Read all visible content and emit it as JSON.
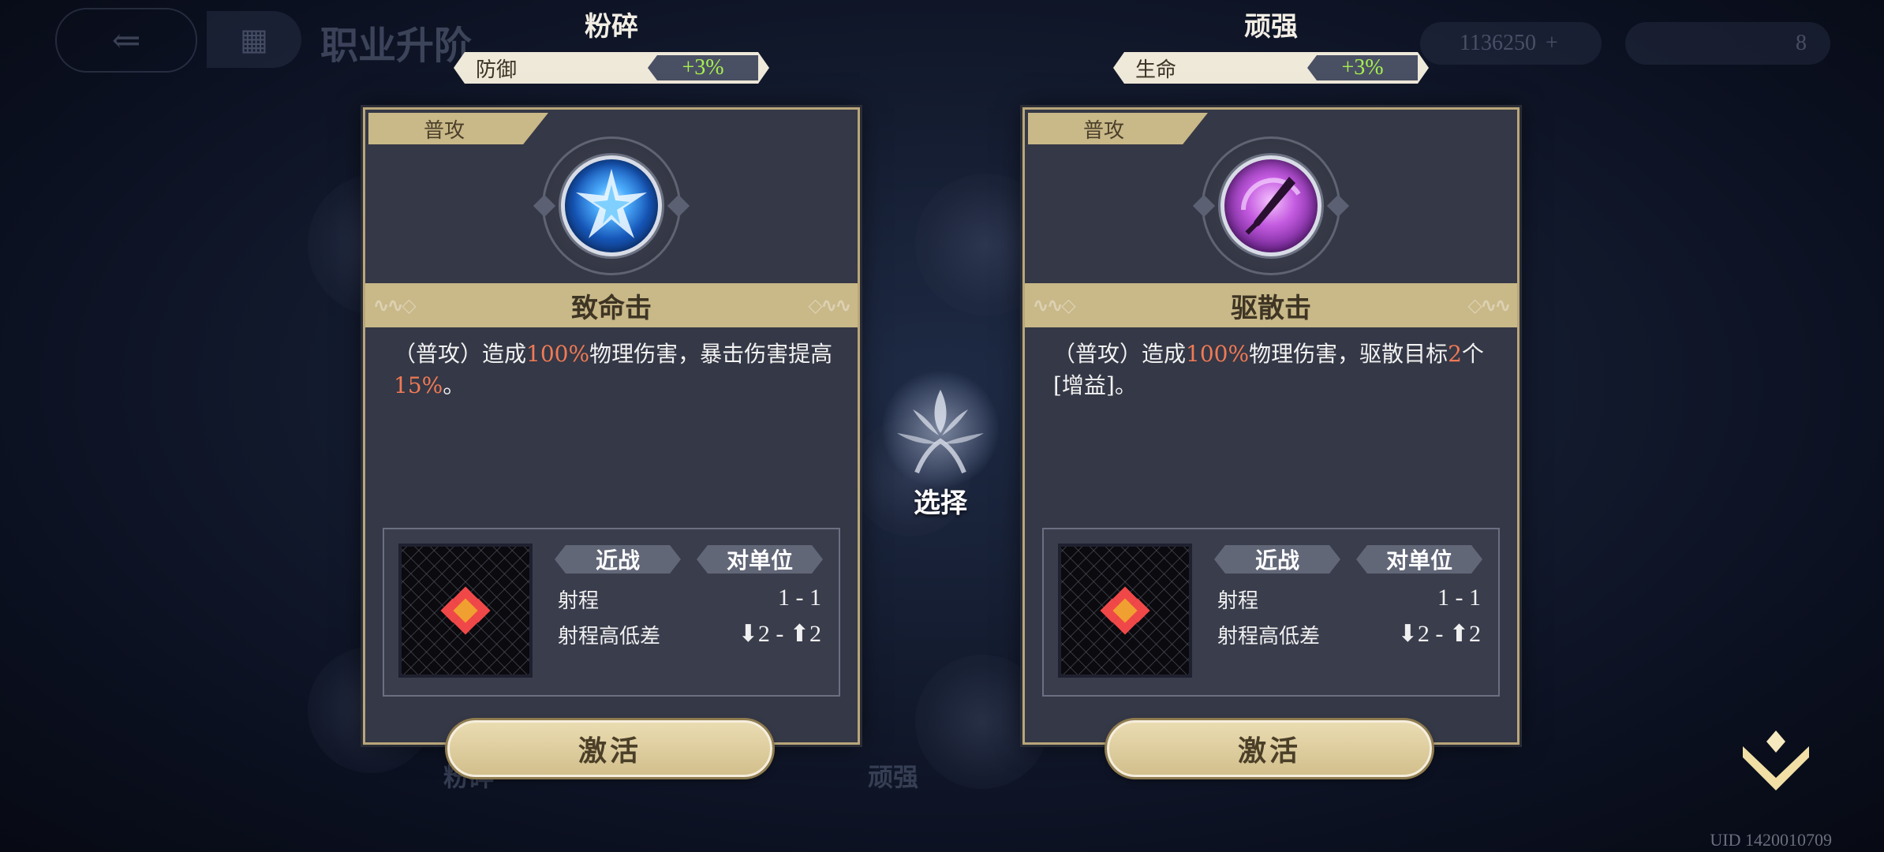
{
  "background": {
    "title": "职业升阶",
    "resource_value": "1136250",
    "resource_plus": "+",
    "second_value": "8",
    "label_left": "粉碎",
    "label_right": "顽强"
  },
  "choices": [
    {
      "name": "粉碎",
      "stat_label": "防御",
      "stat_value": "+3%",
      "tag": "普攻",
      "skill_name": "致命击",
      "description": {
        "p1": "（普攻）造成",
        "h1": "100%",
        "p2": "物理伤害，暴击伤害提高",
        "h2": "15%",
        "p3": "。"
      },
      "pill_1": "近战",
      "pill_2": "对单位",
      "range_label": "射程",
      "range_value": "1 - 1",
      "height_label": "射程高低差",
      "height_value": "⬇2 - ⬆2",
      "activate": "激活"
    },
    {
      "name": "顽强",
      "stat_label": "生命",
      "stat_value": "+3%",
      "tag": "普攻",
      "skill_name": "驱散击",
      "description": {
        "p1": "（普攻）造成",
        "h1": "100%",
        "p2": "物理伤害，驱散目标",
        "h2": "2",
        "p3": "个[增益]。"
      },
      "pill_1": "近战",
      "pill_2": "对单位",
      "range_label": "射程",
      "range_value": "1 - 1",
      "height_label": "射程高低差",
      "height_value": "⬇2 - ⬆2",
      "activate": "激活"
    }
  ],
  "center": {
    "label": "选择"
  },
  "uid": "UID 1420010709",
  "colors": {
    "gold": "#c9b888",
    "highlight": "#f07a55",
    "stat_green": "#a6f04e",
    "card_bg": "#353846"
  },
  "icons": {
    "back": "back-arrow-icon",
    "menu": "grid-menu-icon",
    "skill_1": "shattered-star-icon",
    "skill_2": "dispel-sword-icon",
    "center": "tree-emblem-icon",
    "collapse": "chevron-down-icon"
  }
}
